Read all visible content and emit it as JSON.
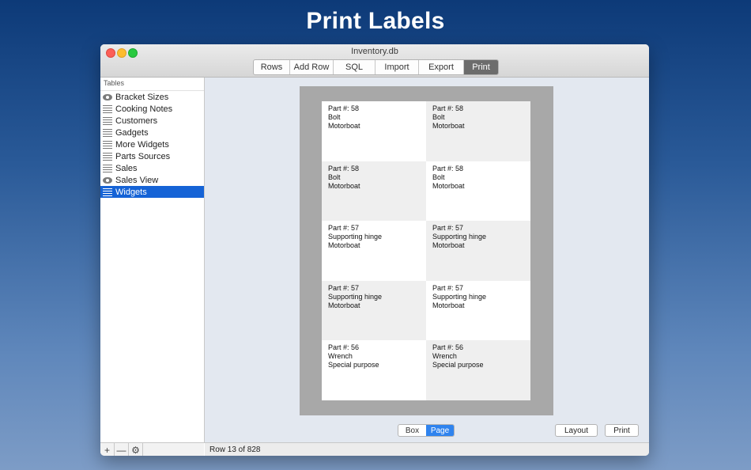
{
  "hero_title": "Print Labels",
  "window": {
    "title": "Inventory.db",
    "toolbar_tabs": [
      {
        "label": "Rows",
        "active": false
      },
      {
        "label": "Add Row",
        "active": false
      },
      {
        "label": "SQL",
        "active": false
      },
      {
        "label": "Import",
        "active": false
      },
      {
        "label": "Export",
        "active": false
      },
      {
        "label": "Print",
        "active": true
      }
    ]
  },
  "sidebar": {
    "header": "Tables",
    "items": [
      {
        "label": "Bracket Sizes",
        "icon": "eye-icon"
      },
      {
        "label": "Cooking Notes",
        "icon": "table-icon"
      },
      {
        "label": "Customers",
        "icon": "table-icon"
      },
      {
        "label": "Gadgets",
        "icon": "table-icon"
      },
      {
        "label": "More Widgets",
        "icon": "table-icon"
      },
      {
        "label": "Parts Sources",
        "icon": "table-icon"
      },
      {
        "label": "Sales",
        "icon": "table-icon"
      },
      {
        "label": "Sales View",
        "icon": "eye-icon"
      },
      {
        "label": "Widgets",
        "icon": "table-icon",
        "selected": true
      }
    ],
    "footer": {
      "add": "+",
      "remove": "—",
      "settings": "⚙"
    }
  },
  "labels": [
    {
      "line1": "Part #: 58",
      "line2": "Bolt",
      "line3": "Motorboat"
    },
    {
      "line1": "Part #: 58",
      "line2": "Bolt",
      "line3": "Motorboat"
    },
    {
      "line1": "Part #: 58",
      "line2": "Bolt",
      "line3": "Motorboat"
    },
    {
      "line1": "Part #: 58",
      "line2": "Bolt",
      "line3": "Motorboat"
    },
    {
      "line1": "Part #: 57",
      "line2": "Supporting hinge",
      "line3": "Motorboat"
    },
    {
      "line1": "Part #: 57",
      "line2": "Supporting hinge",
      "line3": "Motorboat"
    },
    {
      "line1": "Part #: 57",
      "line2": "Supporting hinge",
      "line3": "Motorboat"
    },
    {
      "line1": "Part #: 57",
      "line2": "Supporting hinge",
      "line3": "Motorboat"
    },
    {
      "line1": "Part #: 56",
      "line2": "Wrench",
      "line3": "Special purpose"
    },
    {
      "line1": "Part #: 56",
      "line2": "Wrench",
      "line3": "Special purpose"
    }
  ],
  "view_mode": {
    "box": "Box",
    "page": "Page",
    "selected": "Page"
  },
  "buttons": {
    "layout": "Layout",
    "print": "Print"
  },
  "status": "Row 13 of 828"
}
